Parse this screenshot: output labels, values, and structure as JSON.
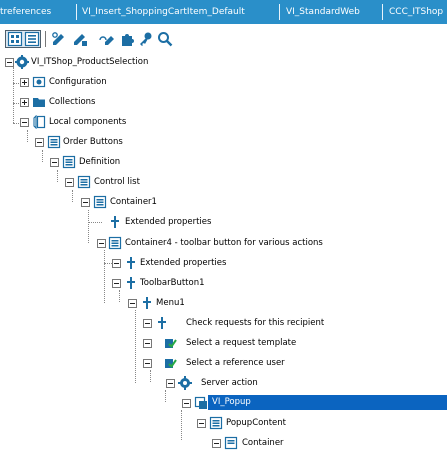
{
  "tabs": [
    {
      "label": "treferences"
    },
    {
      "label": "VI_Insert_ShoppingCartItem_Default"
    },
    {
      "label": "VI_StandardWeb"
    },
    {
      "label": "CCC_ITShop"
    }
  ],
  "toolbar": {
    "buttons": [
      {
        "icon": "object-view-icon"
      },
      {
        "icon": "property-view-icon"
      },
      {
        "icon": "edit-link-icon"
      },
      {
        "icon": "edit-node-icon"
      },
      {
        "icon": "edit-script-icon"
      },
      {
        "icon": "puzzle-icon"
      },
      {
        "icon": "key-icon"
      },
      {
        "icon": "search-icon"
      }
    ]
  },
  "tree": {
    "nodes": [
      {
        "label": "VI_ITShop_ProductSelection",
        "icon": "gear-component-icon"
      },
      {
        "label": "Configuration",
        "icon": "configuration-icon"
      },
      {
        "label": "Collections",
        "icon": "folder-icon"
      },
      {
        "label": "Local components",
        "icon": "local-components-icon"
      },
      {
        "label": "Order Buttons",
        "icon": "container-icon"
      },
      {
        "label": "Definition",
        "icon": "container-icon"
      },
      {
        "label": "Control list",
        "icon": "container-icon"
      },
      {
        "label": "Container1",
        "icon": "container-icon"
      },
      {
        "label": "Extended properties",
        "icon": "property-icon"
      },
      {
        "label": "Container4 - toolbar button for various actions",
        "icon": "container-icon"
      },
      {
        "label": "Extended properties",
        "icon": "property-icon"
      },
      {
        "label": "ToolbarButton1",
        "icon": "property-icon"
      },
      {
        "label": "Menu1",
        "icon": "property-icon"
      },
      {
        "label": "Check requests for this recipient",
        "icon": "property-icon"
      },
      {
        "label": "Select a request template",
        "icon": "green-check-icon"
      },
      {
        "label": "Select a reference user",
        "icon": "green-check-icon"
      },
      {
        "label": "Server action",
        "icon": "server-gear-icon"
      },
      {
        "label": "VI_Popup",
        "icon": "popup-icon",
        "selected": true
      },
      {
        "label": "PopupContent",
        "icon": "container-icon"
      },
      {
        "label": "Container",
        "icon": "container-icon"
      }
    ]
  },
  "colors": {
    "tab_bg": "#2a8fc9",
    "selection": "#0b64c0",
    "icon_blue": "#1c6ea4"
  }
}
